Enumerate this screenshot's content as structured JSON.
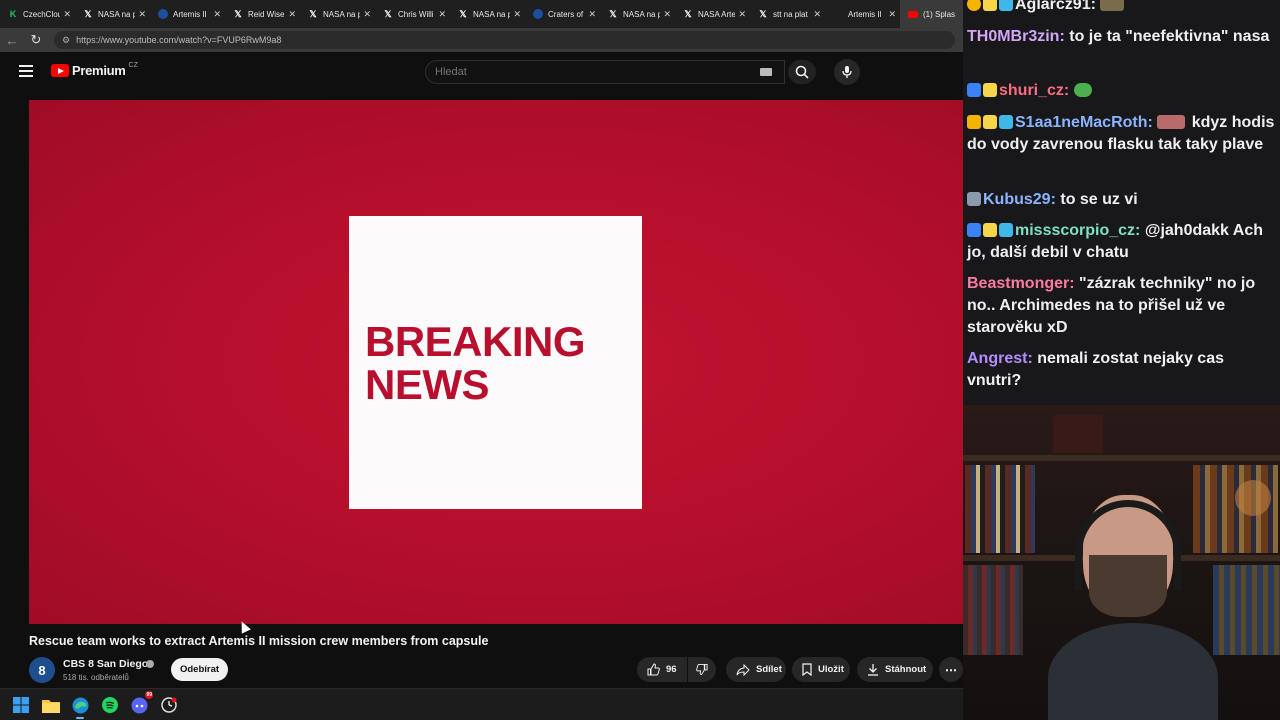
{
  "browser": {
    "tabs": [
      {
        "label": "CzechClou",
        "icon": "czechcloud-icon",
        "icon_color": "#22c55e"
      },
      {
        "label": "NASA na p",
        "icon": "x-icon"
      },
      {
        "label": "Artemis II",
        "icon": "nasa-icon"
      },
      {
        "label": "Reid Wise",
        "icon": "x-icon"
      },
      {
        "label": "NASA na p",
        "icon": "x-icon"
      },
      {
        "label": "Chris Willi",
        "icon": "x-icon"
      },
      {
        "label": "NASA na p",
        "icon": "x-icon"
      },
      {
        "label": "Craters of",
        "icon": "nasa-icon"
      },
      {
        "label": "NASA na p",
        "icon": "x-icon"
      },
      {
        "label": "NASA Arte",
        "icon": "x-icon"
      },
      {
        "label": "stt na plat",
        "icon": "x-icon"
      },
      {
        "label": "Artemis II",
        "icon": "blank-icon"
      },
      {
        "label": "(1) Splas",
        "icon": "youtube-icon"
      }
    ],
    "url": "https://www.youtube.com/watch?v=FVUP6RwM9a8"
  },
  "youtube": {
    "logo_text": "Premium",
    "logo_country": "CZ",
    "search_placeholder": "Hledat",
    "video_card_text_line1": "BREAKING",
    "video_card_text_line2": "NEWS",
    "video_title": "Rescue team works to extract Artemis II mission crew members from capsule",
    "channel": {
      "name": "CBS 8 San Diego",
      "subscribers": "518 tis. odběratelů",
      "avatar_text": "8"
    },
    "subscribe_label": "Odebírat",
    "actions": {
      "likes": "96",
      "share": "Sdílet",
      "save": "Uložit",
      "download": "Stáhnout"
    }
  },
  "chat": {
    "messages": [
      {
        "user": "Aglarcz91:",
        "text": "",
        "color": "#efeff1"
      },
      {
        "user": "TH0MBr3zin:",
        "text": "to je ta \"neefektivna\" nasa",
        "color": "#d2a6f5"
      },
      {
        "user": "shuri_cz:",
        "text": "",
        "color": "#ff6b81"
      },
      {
        "user": "S1aa1neMacRoth:",
        "text": "kdyz hodis do vody zavrenou flasku tak taky plave",
        "color": "#8ab4ff"
      },
      {
        "user": "Kubus29:",
        "text": "to se uz vi",
        "color": "#8ab4ff"
      },
      {
        "user": "missscorpio_cz:",
        "text": "@jah0dakk Ach jo, další debil v chatu",
        "color": "#7ee0c0"
      },
      {
        "user": "Beastmonger:",
        "text": "\"zázrak techniky\" no jo no.. Archimedes na to přišel už ve starověku xD",
        "color": "#ff7aa0"
      },
      {
        "user": "Angrest:",
        "text": "nemali zostat nejaky cas vnutri?",
        "color": "#b48cff"
      }
    ]
  },
  "taskbar": {
    "apps": [
      "windows-start-icon",
      "file-explorer-icon",
      "edge-icon",
      "spotify-icon",
      "discord-icon",
      "clock-app-icon"
    ],
    "discord_badge": "99"
  }
}
